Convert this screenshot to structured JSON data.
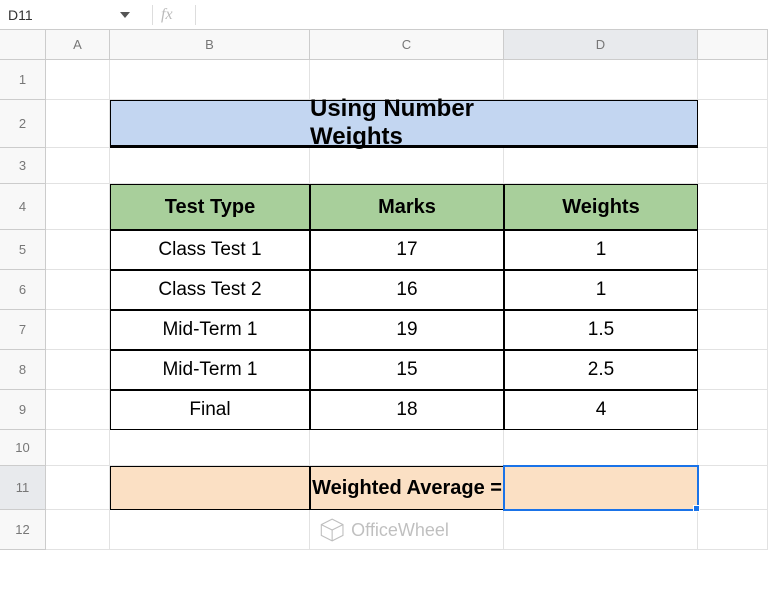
{
  "nameBox": "D11",
  "formula": "",
  "fxLabel": "fx",
  "columns": [
    "A",
    "B",
    "C",
    "D"
  ],
  "rows": [
    "1",
    "2",
    "3",
    "4",
    "5",
    "6",
    "7",
    "8",
    "9",
    "10",
    "11",
    "12"
  ],
  "selectedCol": "D",
  "selectedRow": "11",
  "title": "Using Number Weights",
  "headers": {
    "b": "Test Type",
    "c": "Marks",
    "d": "Weights"
  },
  "tableRows": [
    {
      "b": "Class Test 1",
      "c": "17",
      "d": "1"
    },
    {
      "b": "Class Test 2",
      "c": "16",
      "d": "1"
    },
    {
      "b": "Mid-Term 1",
      "c": "19",
      "d": "1.5"
    },
    {
      "b": "Mid-Term 1",
      "c": "15",
      "d": "2.5"
    },
    {
      "b": "Final",
      "c": "18",
      "d": "4"
    }
  ],
  "weightedAvgLabel": "Weighted Average =",
  "weightedAvgValue": "",
  "watermark": "OfficeWheel",
  "chart_data": {
    "type": "table",
    "title": "Using Number Weights",
    "columns": [
      "Test Type",
      "Marks",
      "Weights"
    ],
    "rows": [
      [
        "Class Test 1",
        17,
        1
      ],
      [
        "Class Test 2",
        16,
        1
      ],
      [
        "Mid-Term 1",
        19,
        1.5
      ],
      [
        "Mid-Term 1",
        15,
        2.5
      ],
      [
        "Final",
        18,
        4
      ]
    ]
  }
}
